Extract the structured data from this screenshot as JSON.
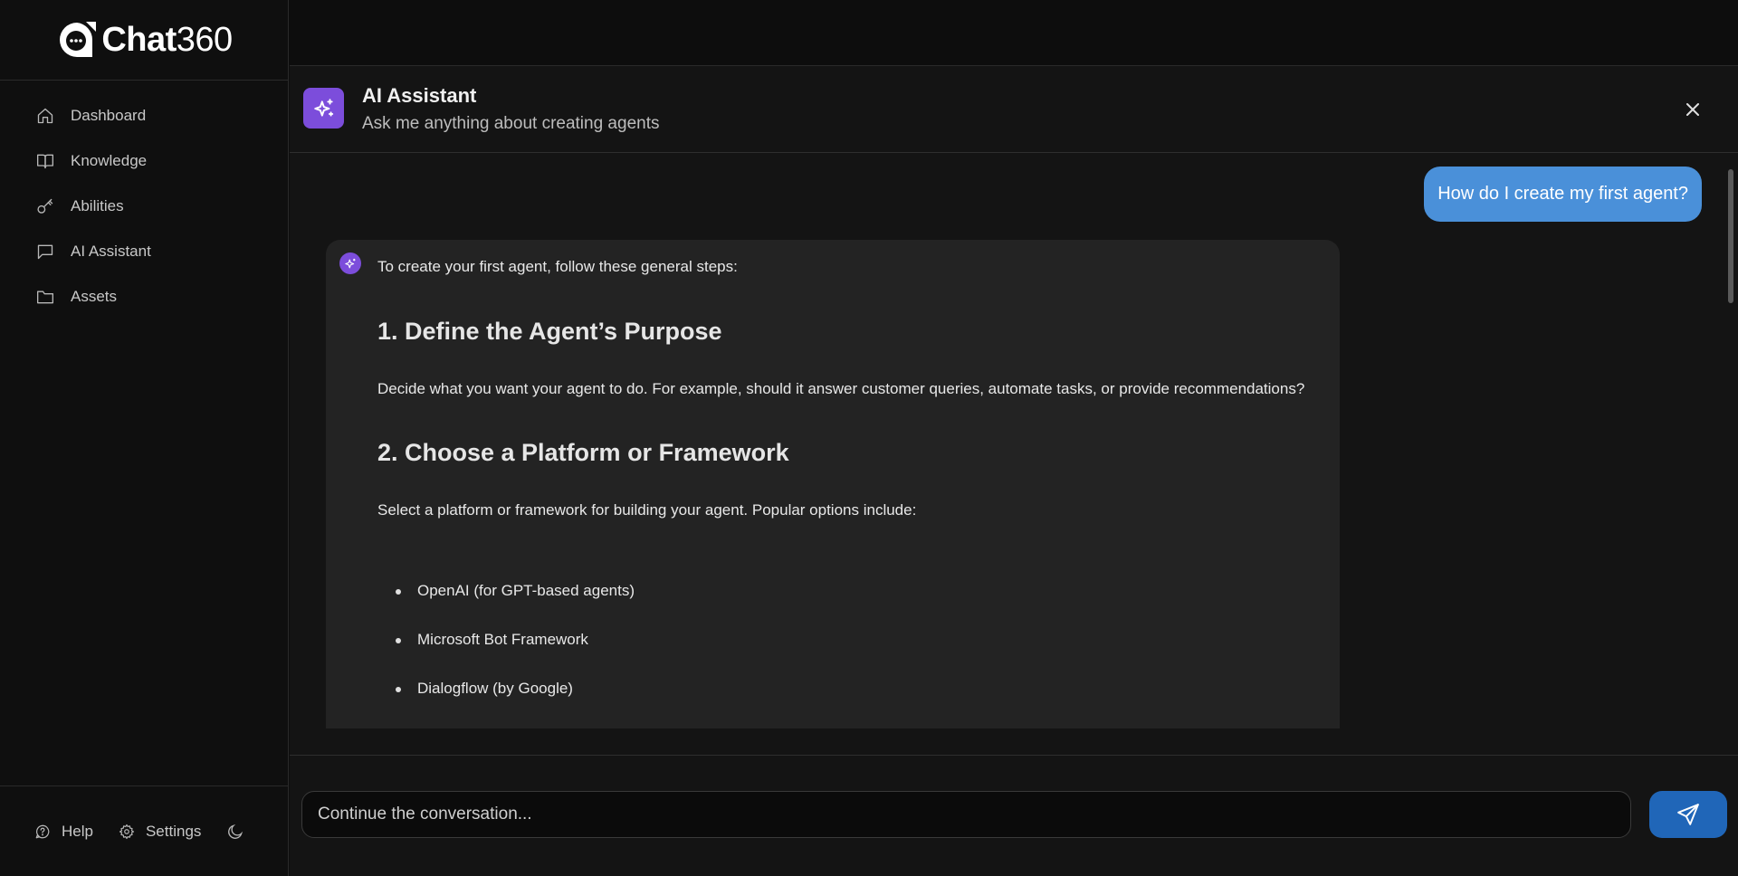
{
  "brand": {
    "name_prefix": "Chat",
    "name_suffix": "360",
    "logo_icon": "chat-bubble-logo-icon"
  },
  "sidebar": {
    "items": [
      {
        "label": "Dashboard",
        "icon": "home-icon"
      },
      {
        "label": "Knowledge",
        "icon": "book-icon"
      },
      {
        "label": "Abilities",
        "icon": "key-icon"
      },
      {
        "label": "AI Assistant",
        "icon": "message-icon"
      },
      {
        "label": "Assets",
        "icon": "folder-icon"
      }
    ],
    "bottom": {
      "help_label": "Help",
      "settings_label": "Settings",
      "theme_icon": "moon-icon"
    }
  },
  "chat_header": {
    "title": "AI Assistant",
    "subtitle": "Ask me anything about creating agents",
    "accent_color": "#7c4ddb"
  },
  "messages": {
    "user": {
      "text": "How do I create my first agent?",
      "bubble_color": "#4a90d9"
    },
    "assistant": {
      "intro": "To create your first agent, follow these general steps:",
      "heading1": "1. Define the Agent’s Purpose",
      "para1": "Decide what you want your agent to do. For example, should it answer customer queries, automate tasks, or provide recommendations?",
      "heading2": "2. Choose a Platform or Framework",
      "para2": "Select a platform or framework for building your agent. Popular options include:",
      "options": [
        "OpenAI (for GPT-based agents)",
        "Microsoft Bot Framework",
        "Dialogflow (by Google)"
      ]
    }
  },
  "composer": {
    "placeholder": "Continue the conversation...",
    "send_color": "#2066b8"
  }
}
